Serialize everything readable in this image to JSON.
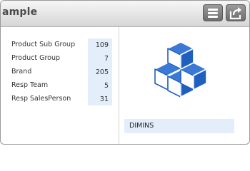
{
  "header": {
    "title": "ample",
    "menu_icon": "hamburger-menu-icon",
    "share_icon": "share-export-icon"
  },
  "rows": [
    {
      "label": "Product Sub Group",
      "value": "109"
    },
    {
      "label": "Product Group",
      "value": "7"
    },
    {
      "label": "Brand",
      "value": "205"
    },
    {
      "label": "Resp Team",
      "value": "5"
    },
    {
      "label": "Resp SalesPerson",
      "value": "31"
    }
  ],
  "right": {
    "logo_icon": "stacked-cubes-icon",
    "bar_label": "DIMINS"
  },
  "colors": {
    "brand_blue": "#1f5fbf",
    "value_background": "#e3eefa",
    "header_button": "#7f7f7f"
  }
}
